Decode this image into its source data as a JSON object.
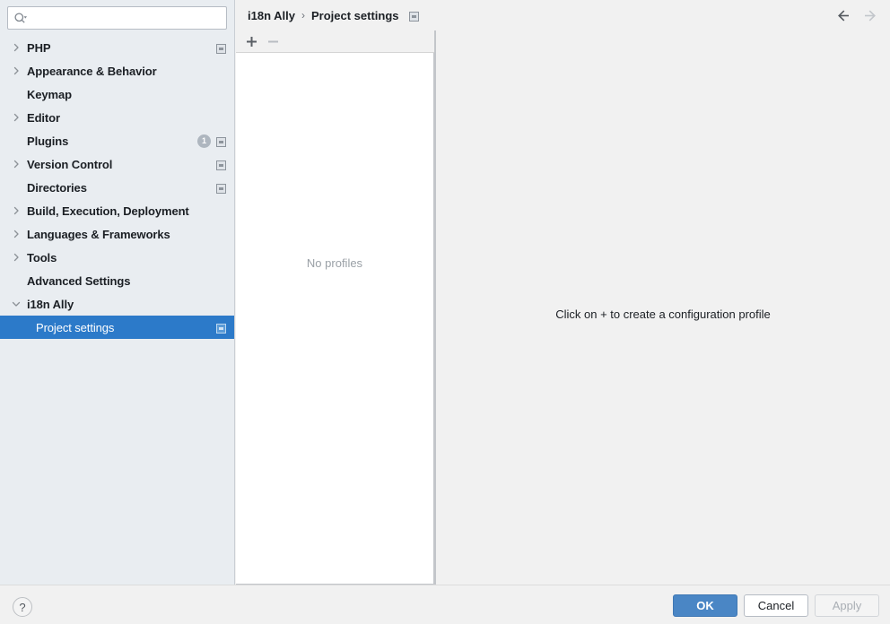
{
  "search": {
    "value": "",
    "placeholder": "",
    "icon": "search-icon"
  },
  "sidebar": {
    "items": [
      {
        "label": "PHP",
        "expandable": true,
        "expanded": false,
        "child": false,
        "scope_icon": true,
        "badge": null
      },
      {
        "label": "Appearance & Behavior",
        "expandable": true,
        "expanded": false,
        "child": false,
        "scope_icon": false,
        "badge": null
      },
      {
        "label": "Keymap",
        "expandable": false,
        "expanded": false,
        "child": false,
        "scope_icon": false,
        "badge": null
      },
      {
        "label": "Editor",
        "expandable": true,
        "expanded": false,
        "child": false,
        "scope_icon": false,
        "badge": null
      },
      {
        "label": "Plugins",
        "expandable": false,
        "expanded": false,
        "child": false,
        "scope_icon": true,
        "badge": "1"
      },
      {
        "label": "Version Control",
        "expandable": true,
        "expanded": false,
        "child": false,
        "scope_icon": true,
        "badge": null
      },
      {
        "label": "Directories",
        "expandable": false,
        "expanded": false,
        "child": false,
        "scope_icon": true,
        "badge": null
      },
      {
        "label": "Build, Execution, Deployment",
        "expandable": true,
        "expanded": false,
        "child": false,
        "scope_icon": false,
        "badge": null
      },
      {
        "label": "Languages & Frameworks",
        "expandable": true,
        "expanded": false,
        "child": false,
        "scope_icon": false,
        "badge": null
      },
      {
        "label": "Tools",
        "expandable": true,
        "expanded": false,
        "child": false,
        "scope_icon": false,
        "badge": null
      },
      {
        "label": "Advanced Settings",
        "expandable": false,
        "expanded": false,
        "child": false,
        "scope_icon": false,
        "badge": null
      },
      {
        "label": "i18n Ally",
        "expandable": true,
        "expanded": true,
        "child": false,
        "scope_icon": false,
        "badge": null
      },
      {
        "label": "Project settings",
        "expandable": false,
        "expanded": false,
        "child": true,
        "scope_icon": true,
        "badge": null,
        "selected": true
      }
    ]
  },
  "breadcrumb": {
    "root": "i18n Ally",
    "separator": "›",
    "current": "Project settings",
    "scope_icon": "project-scope-icon"
  },
  "nav": {
    "back_icon": "arrow-left-icon",
    "forward_icon": "arrow-right-icon",
    "back_enabled": true,
    "forward_enabled": false
  },
  "profiles": {
    "toolbar": {
      "add_icon": "plus-icon",
      "add_enabled": true,
      "remove_icon": "minus-icon",
      "remove_enabled": false
    },
    "empty_text": "No profiles"
  },
  "detail": {
    "hint": "Click on + to create a configuration profile"
  },
  "footer": {
    "help_label": "?",
    "ok_label": "OK",
    "cancel_label": "Cancel",
    "apply_label": "Apply",
    "apply_enabled": false
  },
  "colors": {
    "sidebar_bg": "#e9edf1",
    "selection_blue": "#2c7ac9",
    "primary_button": "#4a86c5",
    "content_bg": "#f1f1f1",
    "muted_text": "#9aa0a6"
  }
}
